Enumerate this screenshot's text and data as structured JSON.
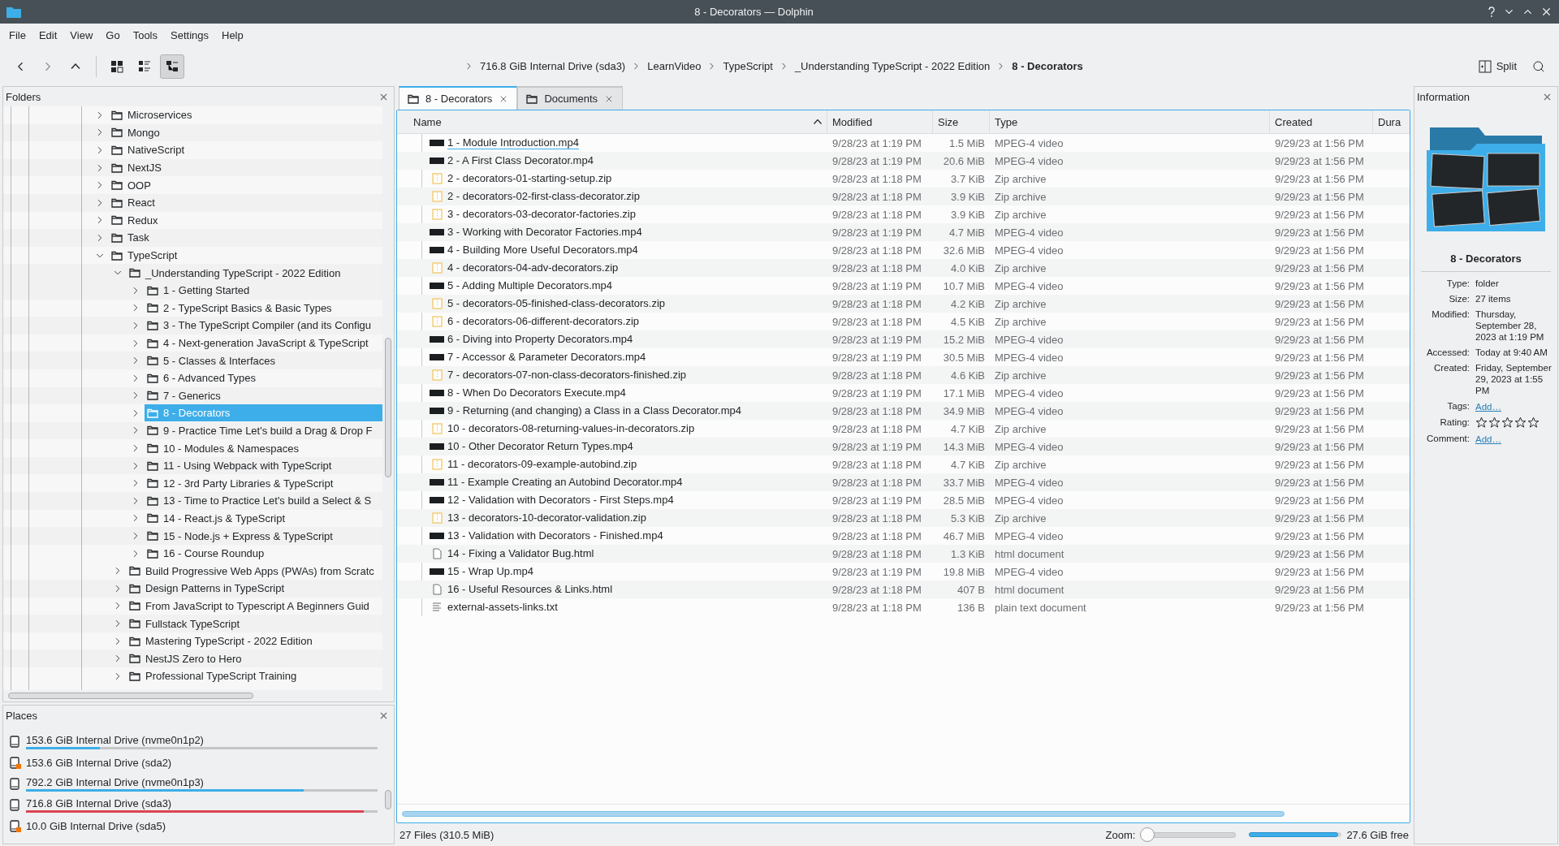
{
  "window": {
    "title": "8 - Decorators — Dolphin"
  },
  "menu": [
    "File",
    "Edit",
    "View",
    "Go",
    "Tools",
    "Settings",
    "Help"
  ],
  "toolbar": {
    "view_modes": [
      {
        "kind": "icons",
        "selected": false
      },
      {
        "kind": "compact",
        "selected": false
      },
      {
        "kind": "details",
        "selected": true
      }
    ],
    "breadcrumb": [
      {
        "label": "716.8 GiB Internal Drive (sda3)",
        "current": false
      },
      {
        "label": "LearnVideo",
        "current": false
      },
      {
        "label": "TypeScript",
        "current": false
      },
      {
        "label": "_Understanding TypeScript - 2022 Edition",
        "current": false
      },
      {
        "label": "8 - Decorators",
        "current": true
      }
    ],
    "split": "Split"
  },
  "folders": {
    "title": "Folders",
    "items": [
      {
        "label": "Microservices",
        "expanded": false,
        "selected": false
      },
      {
        "label": "Mongo",
        "expanded": false,
        "selected": false
      },
      {
        "label": "NativeScript",
        "expanded": false,
        "selected": false
      },
      {
        "label": "NextJS",
        "expanded": false,
        "selected": false
      },
      {
        "label": "OOP",
        "expanded": false,
        "selected": false
      },
      {
        "label": "React",
        "expanded": false,
        "selected": false
      },
      {
        "label": "Redux",
        "expanded": false,
        "selected": false
      },
      {
        "label": "Task",
        "expanded": false,
        "selected": false
      },
      {
        "label": "TypeScript",
        "expanded": true,
        "selected": false,
        "children": [
          {
            "label": "_Understanding TypeScript - 2022 Edition",
            "expanded": true,
            "selected": false,
            "children": [
              {
                "label": "1 - Getting Started",
                "expanded": false,
                "selected": false
              },
              {
                "label": "2 - TypeScript Basics & Basic Types",
                "expanded": false,
                "selected": false
              },
              {
                "label": "3 - The TypeScript Compiler (and its Configu",
                "expanded": false,
                "selected": false
              },
              {
                "label": "4 - Next-generation JavaScript & TypeScript",
                "expanded": false,
                "selected": false
              },
              {
                "label": "5 - Classes & Interfaces",
                "expanded": false,
                "selected": false
              },
              {
                "label": "6 - Advanced Types",
                "expanded": false,
                "selected": false
              },
              {
                "label": "7 - Generics",
                "expanded": false,
                "selected": false
              },
              {
                "label": "8 - Decorators",
                "expanded": false,
                "selected": true
              },
              {
                "label": "9 - Practice Time Let's build a Drag & Drop F",
                "expanded": false,
                "selected": false
              },
              {
                "label": "10 - Modules & Namespaces",
                "expanded": false,
                "selected": false
              },
              {
                "label": "11 - Using Webpack with TypeScript",
                "expanded": false,
                "selected": false
              },
              {
                "label": "12 - 3rd Party Libraries & TypeScript",
                "expanded": false,
                "selected": false
              },
              {
                "label": "13 - Time to Practice Let's build a Select & S",
                "expanded": false,
                "selected": false
              },
              {
                "label": "14 - React.js & TypeScript",
                "expanded": false,
                "selected": false
              },
              {
                "label": "15 - Node.js + Express & TypeScript",
                "expanded": false,
                "selected": false
              },
              {
                "label": "16 - Course Roundup",
                "expanded": false,
                "selected": false
              }
            ]
          },
          {
            "label": "Build Progressive Web Apps (PWAs) from Scratc",
            "expanded": false,
            "selected": false
          },
          {
            "label": "Design Patterns in TypeScript",
            "expanded": false,
            "selected": false
          },
          {
            "label": "From JavaScript to Typescript A Beginners Guid",
            "expanded": false,
            "selected": false
          },
          {
            "label": "Fullstack TypeScript",
            "expanded": false,
            "selected": false
          },
          {
            "label": "Mastering TypeScript - 2022 Edition",
            "expanded": false,
            "selected": false
          },
          {
            "label": "NestJS Zero to Hero",
            "expanded": false,
            "selected": false
          },
          {
            "label": "Professional TypeScript Training",
            "expanded": false,
            "selected": false
          }
        ]
      }
    ]
  },
  "places": {
    "title": "Places",
    "devices": [
      {
        "name": "153.6 GiB Internal Drive (nvme0n1p2)",
        "emblem": false,
        "level": 0.21
      },
      {
        "name": "153.6 GiB Internal Drive (sda2)",
        "emblem": true
      },
      {
        "name": "792.2 GiB Internal Drive (nvme0n1p3)",
        "emblem": false,
        "level": 0.79
      },
      {
        "name": "716.8 GiB Internal Drive (sda3)",
        "emblem": false,
        "level": 0.96
      },
      {
        "name": "10.0 GiB Internal Drive (sda5)",
        "emblem": true
      }
    ]
  },
  "tabs": [
    {
      "label": "8 - Decorators",
      "selected": true
    },
    {
      "label": "Documents",
      "selected": false
    }
  ],
  "files": {
    "columns": [
      {
        "label": "Name",
        "sorted": true
      },
      {
        "label": "Modified",
        "sorted": false
      },
      {
        "label": "Size",
        "sorted": false
      },
      {
        "label": "Type",
        "sorted": false
      },
      {
        "label": "Created",
        "sorted": false
      },
      {
        "label": "Dura",
        "sorted": false
      }
    ],
    "rows": [
      {
        "name": "1 - Module Introduction.mp4",
        "kind": "video",
        "modified": "9/28/23 at 1:19 PM",
        "size": "1.5 MiB",
        "type": "MPEG-4 video",
        "created": "9/29/23 at 1:56 PM",
        "selected": false,
        "current": true
      },
      {
        "name": "2 - A First Class Decorator.mp4",
        "kind": "video",
        "modified": "9/28/23 at 1:19 PM",
        "size": "20.6 MiB",
        "type": "MPEG-4 video",
        "created": "9/29/23 at 1:56 PM",
        "selected": false,
        "current": false
      },
      {
        "name": "2 - decorators-01-starting-setup.zip",
        "kind": "zip",
        "modified": "9/28/23 at 1:18 PM",
        "size": "3.7 KiB",
        "type": "Zip archive",
        "created": "9/29/23 at 1:56 PM",
        "selected": false,
        "current": false
      },
      {
        "name": "2 - decorators-02-first-class-decorator.zip",
        "kind": "zip",
        "modified": "9/28/23 at 1:18 PM",
        "size": "3.9 KiB",
        "type": "Zip archive",
        "created": "9/29/23 at 1:56 PM",
        "selected": false,
        "current": false
      },
      {
        "name": "3 - decorators-03-decorator-factories.zip",
        "kind": "zip",
        "modified": "9/28/23 at 1:18 PM",
        "size": "3.9 KiB",
        "type": "Zip archive",
        "created": "9/29/23 at 1:56 PM",
        "selected": false,
        "current": false
      },
      {
        "name": "3 - Working with Decorator Factories.mp4",
        "kind": "video",
        "modified": "9/28/23 at 1:19 PM",
        "size": "4.7 MiB",
        "type": "MPEG-4 video",
        "created": "9/29/23 at 1:56 PM",
        "selected": false,
        "current": false
      },
      {
        "name": "4 - Building More Useful Decorators.mp4",
        "kind": "video",
        "modified": "9/28/23 at 1:18 PM",
        "size": "32.6 MiB",
        "type": "MPEG-4 video",
        "created": "9/29/23 at 1:56 PM",
        "selected": false,
        "current": false
      },
      {
        "name": "4 - decorators-04-adv-decorators.zip",
        "kind": "zip",
        "modified": "9/28/23 at 1:18 PM",
        "size": "4.0 KiB",
        "type": "Zip archive",
        "created": "9/29/23 at 1:56 PM",
        "selected": false,
        "current": false
      },
      {
        "name": "5 - Adding Multiple Decorators.mp4",
        "kind": "video",
        "modified": "9/28/23 at 1:19 PM",
        "size": "10.7 MiB",
        "type": "MPEG-4 video",
        "created": "9/29/23 at 1:56 PM",
        "selected": false,
        "current": false
      },
      {
        "name": "5 - decorators-05-finished-class-decorators.zip",
        "kind": "zip",
        "modified": "9/28/23 at 1:18 PM",
        "size": "4.2 KiB",
        "type": "Zip archive",
        "created": "9/29/23 at 1:56 PM",
        "selected": false,
        "current": false
      },
      {
        "name": "6 - decorators-06-different-decorators.zip",
        "kind": "zip",
        "modified": "9/28/23 at 1:18 PM",
        "size": "4.5 KiB",
        "type": "Zip archive",
        "created": "9/29/23 at 1:56 PM",
        "selected": false,
        "current": false
      },
      {
        "name": "6 - Diving into Property Decorators.mp4",
        "kind": "video",
        "modified": "9/28/23 at 1:19 PM",
        "size": "15.2 MiB",
        "type": "MPEG-4 video",
        "created": "9/29/23 at 1:56 PM",
        "selected": false,
        "current": false
      },
      {
        "name": "7 - Accessor & Parameter Decorators.mp4",
        "kind": "video",
        "modified": "9/28/23 at 1:19 PM",
        "size": "30.5 MiB",
        "type": "MPEG-4 video",
        "created": "9/29/23 at 1:56 PM",
        "selected": false,
        "current": false
      },
      {
        "name": "7 - decorators-07-non-class-decorators-finished.zip",
        "kind": "zip",
        "modified": "9/28/23 at 1:18 PM",
        "size": "4.6 KiB",
        "type": "Zip archive",
        "created": "9/29/23 at 1:56 PM",
        "selected": false,
        "current": false
      },
      {
        "name": "8 - When Do Decorators Execute.mp4",
        "kind": "video",
        "modified": "9/28/23 at 1:19 PM",
        "size": "17.1 MiB",
        "type": "MPEG-4 video",
        "created": "9/29/23 at 1:56 PM",
        "selected": false,
        "current": false
      },
      {
        "name": "9 - Returning (and changing) a Class in a Class Decorator.mp4",
        "kind": "video",
        "modified": "9/28/23 at 1:18 PM",
        "size": "34.9 MiB",
        "type": "MPEG-4 video",
        "created": "9/29/23 at 1:56 PM",
        "selected": false,
        "current": false
      },
      {
        "name": "10 - decorators-08-returning-values-in-decorators.zip",
        "kind": "zip",
        "modified": "9/28/23 at 1:18 PM",
        "size": "4.7 KiB",
        "type": "Zip archive",
        "created": "9/29/23 at 1:56 PM",
        "selected": false,
        "current": false
      },
      {
        "name": "10 - Other Decorator Return Types.mp4",
        "kind": "video",
        "modified": "9/28/23 at 1:19 PM",
        "size": "14.3 MiB",
        "type": "MPEG-4 video",
        "created": "9/29/23 at 1:56 PM",
        "selected": false,
        "current": false
      },
      {
        "name": "11 - decorators-09-example-autobind.zip",
        "kind": "zip",
        "modified": "9/28/23 at 1:18 PM",
        "size": "4.7 KiB",
        "type": "Zip archive",
        "created": "9/29/23 at 1:56 PM",
        "selected": false,
        "current": false
      },
      {
        "name": "11 - Example Creating an Autobind Decorator.mp4",
        "kind": "video",
        "modified": "9/28/23 at 1:18 PM",
        "size": "33.7 MiB",
        "type": "MPEG-4 video",
        "created": "9/29/23 at 1:56 PM",
        "selected": false,
        "current": false
      },
      {
        "name": "12 - Validation with Decorators - First Steps.mp4",
        "kind": "video",
        "modified": "9/28/23 at 1:19 PM",
        "size": "28.5 MiB",
        "type": "MPEG-4 video",
        "created": "9/29/23 at 1:56 PM",
        "selected": false,
        "current": false
      },
      {
        "name": "13 - decorators-10-decorator-validation.zip",
        "kind": "zip",
        "modified": "9/28/23 at 1:18 PM",
        "size": "5.3 KiB",
        "type": "Zip archive",
        "created": "9/29/23 at 1:56 PM",
        "selected": false,
        "current": false
      },
      {
        "name": "13 - Validation with Decorators - Finished.mp4",
        "kind": "video",
        "modified": "9/28/23 at 1:18 PM",
        "size": "46.7 MiB",
        "type": "MPEG-4 video",
        "created": "9/29/23 at 1:56 PM",
        "selected": false,
        "current": false
      },
      {
        "name": "14 - Fixing a Validator Bug.html",
        "kind": "html",
        "modified": "9/28/23 at 1:18 PM",
        "size": "1.3 KiB",
        "type": "html document",
        "created": "9/29/23 at 1:56 PM",
        "selected": false,
        "current": false
      },
      {
        "name": "15 - Wrap Up.mp4",
        "kind": "video",
        "modified": "9/28/23 at 1:19 PM",
        "size": "19.8 MiB",
        "type": "MPEG-4 video",
        "created": "9/29/23 at 1:56 PM",
        "selected": false,
        "current": false
      },
      {
        "name": "16 - Useful Resources & Links.html",
        "kind": "html",
        "modified": "9/28/23 at 1:18 PM",
        "size": "407 B",
        "type": "html document",
        "created": "9/29/23 at 1:56 PM",
        "selected": false,
        "current": false
      },
      {
        "name": "external-assets-links.txt",
        "kind": "text",
        "modified": "9/28/23 at 1:18 PM",
        "size": "136 B",
        "type": "plain text document",
        "created": "9/29/23 at 1:56 PM",
        "selected": false,
        "current": false
      }
    ]
  },
  "status": {
    "summary": "27 Files (310.5 MiB)",
    "zoom_label": "Zoom:",
    "zoom": {
      "level": 0
    },
    "free": {
      "level": 0.96
    },
    "free_label": "27.6 GiB free"
  },
  "info": {
    "title": "Information",
    "name": "8 - Decorators",
    "fields": [
      {
        "label": "Type:",
        "kind": "text",
        "value": "folder"
      },
      {
        "label": "Size:",
        "kind": "text",
        "value": "27 items"
      },
      {
        "label": "Modified:",
        "kind": "text",
        "value": "Thursday, September 28, 2023 at 1:19 PM"
      },
      {
        "label": "Accessed:",
        "kind": "text",
        "value": "Today at 9:40 AM"
      },
      {
        "label": "Created:",
        "kind": "text",
        "value": "Friday, September 29, 2023 at 1:55 PM"
      },
      {
        "label": "Tags:",
        "kind": "link",
        "value": "Add…"
      },
      {
        "label": "Rating:",
        "kind": "rating",
        "stars": 0
      },
      {
        "label": "Comment:",
        "kind": "link",
        "value": "Add…"
      }
    ]
  }
}
